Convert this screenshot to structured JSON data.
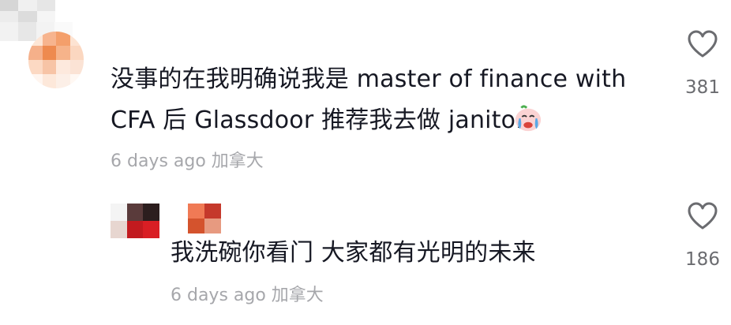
{
  "comment": {
    "text_line1": "没事的在我明确说我是 master of finance with",
    "text_line2": "CFA 后 Glassdoor 推荐我去做 janitor",
    "emoji": "crying-face-emoji",
    "meta": "6 days ago 加拿大",
    "likes": "381"
  },
  "reply": {
    "text": "我洗碗你看门 大家都有光明的未来",
    "meta": "6 days ago 加拿大",
    "likes": "186"
  },
  "colors": {
    "text": "#161823",
    "meta": "#a6a7ab",
    "like_count": "#6b6c70",
    "avatar_orange": "#f0a070",
    "avatar_red": "#c0292e"
  }
}
